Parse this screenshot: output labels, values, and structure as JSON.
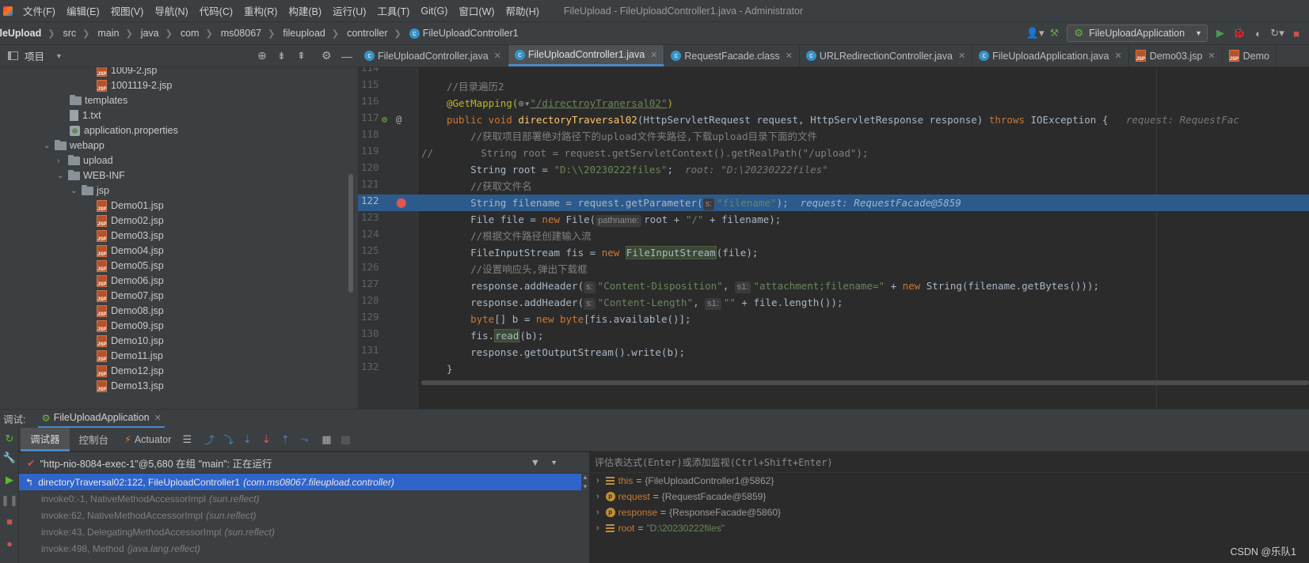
{
  "menu": {
    "items": [
      "文件(F)",
      "编辑(E)",
      "视图(V)",
      "导航(N)",
      "代码(C)",
      "重构(R)",
      "构建(B)",
      "运行(U)",
      "工具(T)",
      "Git(G)",
      "窗口(W)",
      "帮助(H)"
    ],
    "window_title": "FileUpload - FileUploadController1.java - Administrator"
  },
  "breadcrumb": [
    "ileUpload",
    "src",
    "main",
    "java",
    "com",
    "ms08067",
    "fileupload",
    "controller",
    "FileUploadController1"
  ],
  "run_config": {
    "label": "FileUploadApplication"
  },
  "project_panel": {
    "title": "项目",
    "tree": [
      {
        "label": "1009-2.jsp",
        "type": "jsp"
      },
      {
        "label": "1001119-2.jsp",
        "type": "jsp"
      },
      {
        "label": "templates",
        "type": "folder"
      },
      {
        "label": "1.txt",
        "type": "txt"
      },
      {
        "label": "application.properties",
        "type": "properties"
      },
      {
        "label": "webapp",
        "type": "folder"
      },
      {
        "label": "upload",
        "type": "folder"
      },
      {
        "label": "WEB-INF",
        "type": "folder"
      },
      {
        "label": "jsp",
        "type": "folder"
      },
      {
        "label": "Demo01.jsp",
        "type": "jsp"
      },
      {
        "label": "Demo02.jsp",
        "type": "jsp"
      },
      {
        "label": "Demo03.jsp",
        "type": "jsp"
      },
      {
        "label": "Demo04.jsp",
        "type": "jsp"
      },
      {
        "label": "Demo05.jsp",
        "type": "jsp"
      },
      {
        "label": "Demo06.jsp",
        "type": "jsp"
      },
      {
        "label": "Demo07.jsp",
        "type": "jsp"
      },
      {
        "label": "Demo08.jsp",
        "type": "jsp"
      },
      {
        "label": "Demo09.jsp",
        "type": "jsp"
      },
      {
        "label": "Demo10.jsp",
        "type": "jsp"
      },
      {
        "label": "Demo11.jsp",
        "type": "jsp"
      },
      {
        "label": "Demo12.jsp",
        "type": "jsp"
      },
      {
        "label": "Demo13.jsp",
        "type": "jsp"
      }
    ]
  },
  "editor_tabs": [
    {
      "label": "FileUploadController.java",
      "icon": "class-icon",
      "active": false
    },
    {
      "label": "FileUploadController1.java",
      "icon": "class-icon",
      "active": true
    },
    {
      "label": "RequestFacade.class",
      "icon": "class-icon",
      "active": false
    },
    {
      "label": "URLRedirectionController.java",
      "icon": "class-icon",
      "active": false
    },
    {
      "label": "FileUploadApplication.java",
      "icon": "spring-class-icon",
      "active": false
    },
    {
      "label": "Demo03.jsp",
      "icon": "jsp-icon",
      "active": false
    },
    {
      "label": "Demo",
      "icon": "jsp-icon",
      "active": false
    }
  ],
  "code": {
    "line_numbers": [
      "114",
      "115",
      "116",
      "117",
      "118",
      "119",
      "120",
      "121",
      "122",
      "123",
      "124",
      "125",
      "126",
      "127",
      "128",
      "129",
      "130",
      "131",
      "132"
    ],
    "highlighted_line": "122",
    "text": {
      "l115_comment": "//目录遍历2",
      "l116_ann": "@GetMapping(",
      "l116_path": "\"/directroyTranersal02\"",
      "l116_close": ")",
      "l117_pub": "public void ",
      "l117_fn": "directoryTraversal02",
      "l117_params": "(HttpServletRequest request, HttpServletResponse response) ",
      "l117_throws": "throws ",
      "l117_exc": "IOException {",
      "l117_hint": "request: RequestFac",
      "l118_comment": "//获取项目部署绝对路径下的upload文件夹路径,下载upload目录下面的文件",
      "l119_comment": "//        String root = request.getServletContext().getRealPath(\"/upload\");",
      "l120_a": "String root = ",
      "l120_str": "\"D:\\\\20230222files\"",
      "l120_b": ";",
      "l120_hint": "root: \"D:\\20230222files\"",
      "l121_comment": "//获取文件名",
      "l122_a": "String filename = request.getParameter(",
      "l122_ph": "s:",
      "l122_str": "\"filename\"",
      "l122_b": ");",
      "l122_hint": "request: RequestFacade@5859",
      "l123_a": "File file = ",
      "l123_new": "new ",
      "l123_b": "File(",
      "l123_ph": "pathname:",
      "l123_c": "root + ",
      "l123_str": "\"/\"",
      "l123_d": " + filename);",
      "l124_comment": "//根据文件路径创建输入流",
      "l125_a": "FileInputStream fis = ",
      "l125_new": "new ",
      "l125_box": "FileInputStream",
      "l125_b": "(file);",
      "l126_comment": "//设置响应头,弹出下载框",
      "l127_a": "response.addHeader(",
      "l127_ph1": "s:",
      "l127_str1": "\"Content-Disposition\"",
      "l127_b": ", ",
      "l127_ph2": "s1:",
      "l127_str2": "\"attachment;filename=\"",
      "l127_c": " + ",
      "l127_new": "new ",
      "l127_d": "String(filename.getBytes()));",
      "l128_a": "response.addHeader(",
      "l128_ph1": "s:",
      "l128_str1": "\"Content-Length\"",
      "l128_b": ", ",
      "l128_ph2": "s1:",
      "l128_str2": "\"\"",
      "l128_c": " + file.length());",
      "l129_kw1": "byte",
      "l129_a": "[] b = ",
      "l129_new": "new ",
      "l129_kw2": "byte",
      "l129_b": "[fis.available()];",
      "l130_a": "fis.",
      "l130_box": "read",
      "l130_b": "(b);",
      "l131_a": "response.getOutputStream().write(b);",
      "l132_a": "}"
    }
  },
  "debug": {
    "label": "调试:",
    "session": "FileUploadApplication",
    "tabs": [
      "调试器",
      "控制台",
      "Actuator"
    ],
    "thread": "\"http-nio-8084-exec-1\"@5,680 在组 \"main\": 正在运行",
    "frames": [
      {
        "method": "directoryTraversal02:122, FileUploadController1",
        "pkg": "(com.ms08067.fileupload.controller)",
        "selected": true
      },
      {
        "method": "invoke0:-1, NativeMethodAccessorImpl",
        "pkg": "(sun.reflect)",
        "selected": false
      },
      {
        "method": "invoke:62, NativeMethodAccessorImpl",
        "pkg": "(sun.reflect)",
        "selected": false
      },
      {
        "method": "invoke:43, DelegatingMethodAccessorImpl",
        "pkg": "(sun.reflect)",
        "selected": false
      },
      {
        "method": "invoke:498, Method",
        "pkg": "(java.lang.reflect)",
        "selected": false
      }
    ],
    "eval_placeholder": "评估表达式(Enter)或添加监视(Ctrl+Shift+Enter)",
    "variables": [
      {
        "name": "this",
        "value": "{FileUploadController1@5862}",
        "icon": "field-icon"
      },
      {
        "name": "request",
        "value": "{RequestFacade@5859}",
        "icon": "param-icon"
      },
      {
        "name": "response",
        "value": "{ResponseFacade@5860}",
        "icon": "param-icon"
      },
      {
        "name": "root",
        "value": "\"D:\\20230222files\"",
        "icon": "field-icon"
      }
    ]
  },
  "watermark": "CSDN @乐队1"
}
